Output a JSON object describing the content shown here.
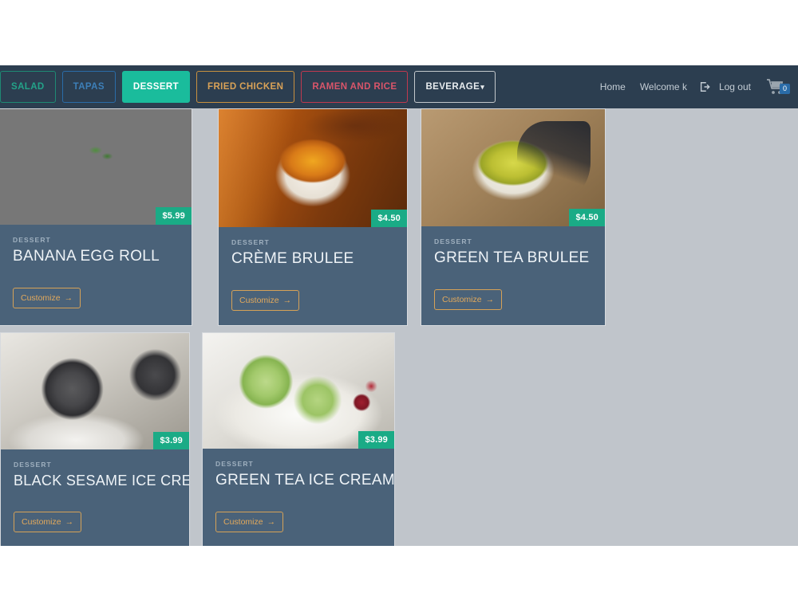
{
  "navbar": {
    "categories": [
      {
        "label": "SALAD",
        "style": "salad",
        "name": "nav-category-salad"
      },
      {
        "label": "TAPAS",
        "style": "tapas",
        "name": "nav-category-tapas"
      },
      {
        "label": "DESSERT",
        "style": "dessert",
        "name": "nav-category-dessert"
      },
      {
        "label": "FRIED CHICKEN",
        "style": "chicken",
        "name": "nav-category-fried-chicken"
      },
      {
        "label": "RAMEN AND RICE",
        "style": "ramen",
        "name": "nav-category-ramen-and-rice"
      },
      {
        "label": "BEVERAGE",
        "style": "beverage",
        "name": "nav-category-beverage",
        "caret": "▾"
      }
    ],
    "active_category": "DESSERT",
    "home_label": "Home",
    "welcome_label": "Welcome k",
    "logout_label": "Log out",
    "cart_count": "0",
    "colors": {
      "navbar_bg": "#2c3e50",
      "accent_teal": "#1abc9c",
      "badge_blue": "#2a6ca8",
      "price_green": "#1aab86",
      "card_bg": "#4a6279",
      "customize_orange": "#d6a257",
      "content_bg": "#c0c5cb"
    }
  },
  "products": [
    {
      "category": "DESSERT",
      "title": "BANANA EGG ROLL",
      "price": "$5.99",
      "button": "Customize",
      "button_arrow": "→",
      "art": "art-banana",
      "image_alt": "banana-egg-roll-photo"
    },
    {
      "category": "DESSERT",
      "title": "CRÈME BRULEE",
      "price": "$4.50",
      "button": "Customize",
      "button_arrow": "→",
      "art": "art-brulee",
      "image_alt": "creme-brulee-photo"
    },
    {
      "category": "DESSERT",
      "title": "GREEN TEA BRULEE",
      "price": "$4.50",
      "button": "Customize",
      "button_arrow": "→",
      "art": "art-gtbrulee",
      "image_alt": "green-tea-brulee-photo"
    },
    {
      "category": "DESSERT",
      "title": "BLACK SESAME ICE CREAM",
      "price": "$3.99",
      "button": "Customize",
      "button_arrow": "→",
      "art": "art-sesame",
      "image_alt": "black-sesame-ice-cream-photo"
    },
    {
      "category": "DESSERT",
      "title": "GREEN TEA ICE CREAM",
      "price": "$3.99",
      "button": "Customize",
      "button_arrow": "→",
      "art": "art-gtice",
      "image_alt": "green-tea-ice-cream-photo"
    }
  ]
}
